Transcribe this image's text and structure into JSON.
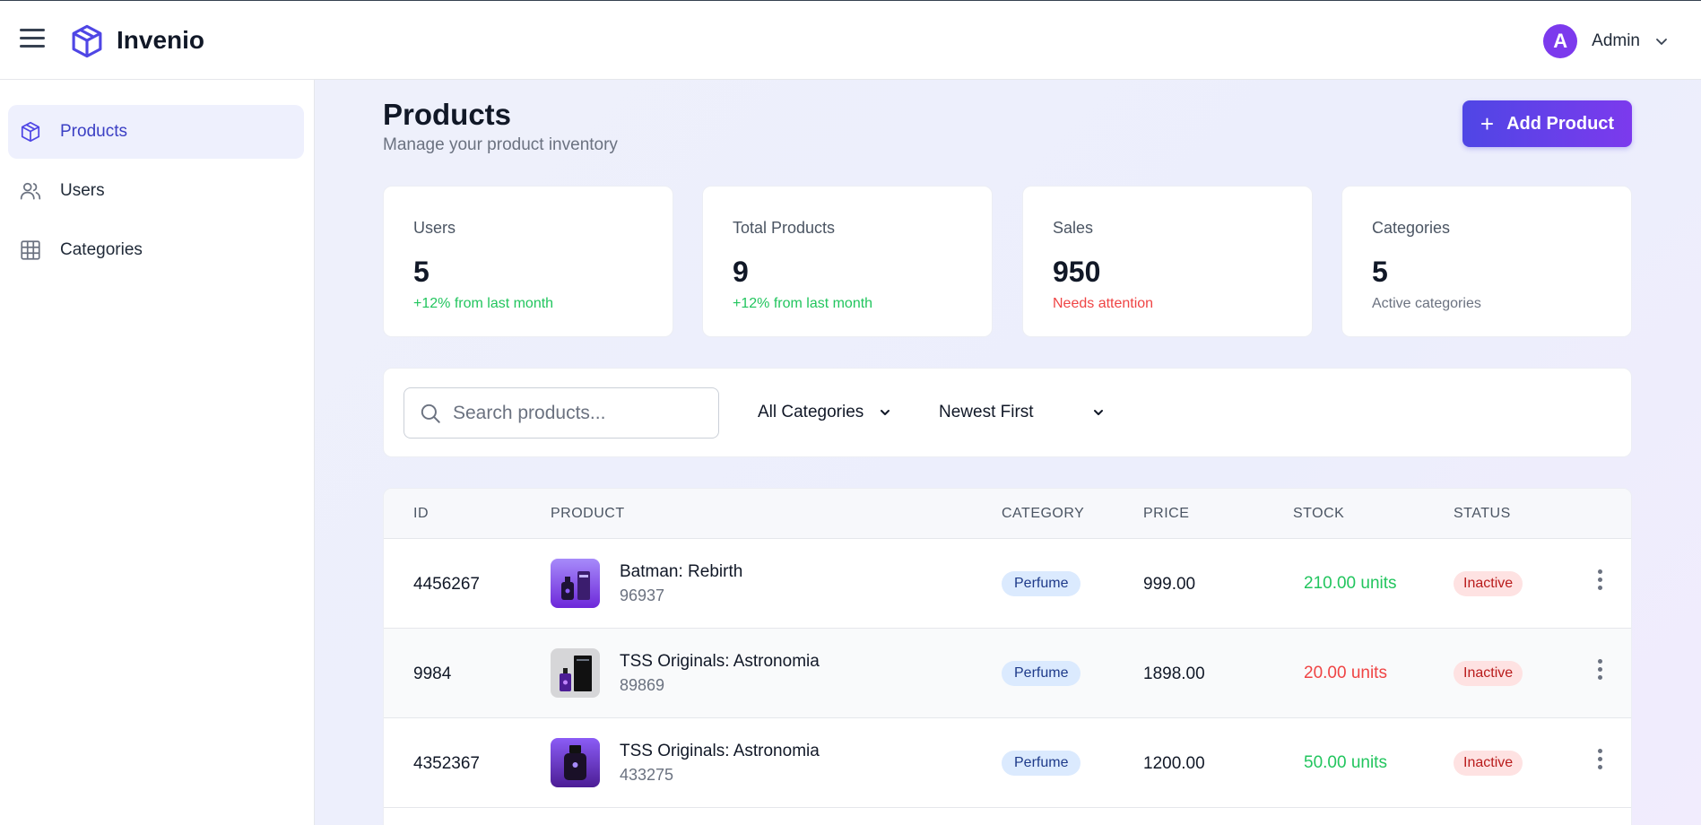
{
  "header": {
    "brand": "Invenio",
    "user": {
      "initial": "A",
      "name": "Admin"
    }
  },
  "sidebar": {
    "items": [
      {
        "label": "Products",
        "icon": "cube-icon",
        "active": true
      },
      {
        "label": "Users",
        "icon": "users-icon",
        "active": false
      },
      {
        "label": "Categories",
        "icon": "grid-icon",
        "active": false
      }
    ]
  },
  "page": {
    "title": "Products",
    "subtitle": "Manage your product inventory",
    "add_button": "Add Product"
  },
  "stats": [
    {
      "label": "Users",
      "value": "5",
      "note": "+12% from last month",
      "note_color": "#22c55e"
    },
    {
      "label": "Total Products",
      "value": "9",
      "note": "+12% from last month",
      "note_color": "#22c55e"
    },
    {
      "label": "Sales",
      "value": "950",
      "note": "Needs attention",
      "note_color": "#ef4444"
    },
    {
      "label": "Categories",
      "value": "5",
      "note": "Active categories",
      "note_color": "#6b7280"
    }
  ],
  "filters": {
    "search_placeholder": "Search products...",
    "category": "All Categories",
    "sort": "Newest First"
  },
  "table": {
    "headers": [
      "ID",
      "PRODUCT",
      "CATEGORY",
      "PRICE",
      "STOCK",
      "STATUS"
    ],
    "rows": [
      {
        "id": "4456267",
        "name": "Batman: Rebirth",
        "sku": "96937",
        "category": "Perfume",
        "price": "999.00",
        "stock": "210.00 units",
        "stock_color": "#22c55e",
        "status": "Inactive"
      },
      {
        "id": "9984",
        "name": "TSS Originals: Astronomia",
        "sku": "89869",
        "category": "Perfume",
        "price": "1898.00",
        "stock": "20.00 units",
        "stock_color": "#ef4444",
        "status": "Inactive"
      },
      {
        "id": "4352367",
        "name": "TSS Originals: Astronomia",
        "sku": "433275",
        "category": "Perfume",
        "price": "1200.00",
        "stock": "50.00 units",
        "stock_color": "#22c55e",
        "status": "Inactive"
      }
    ]
  },
  "colors": {
    "accent": "#4f46e5",
    "accent_end": "#7c3aed",
    "success": "#22c55e",
    "danger": "#ef4444"
  }
}
